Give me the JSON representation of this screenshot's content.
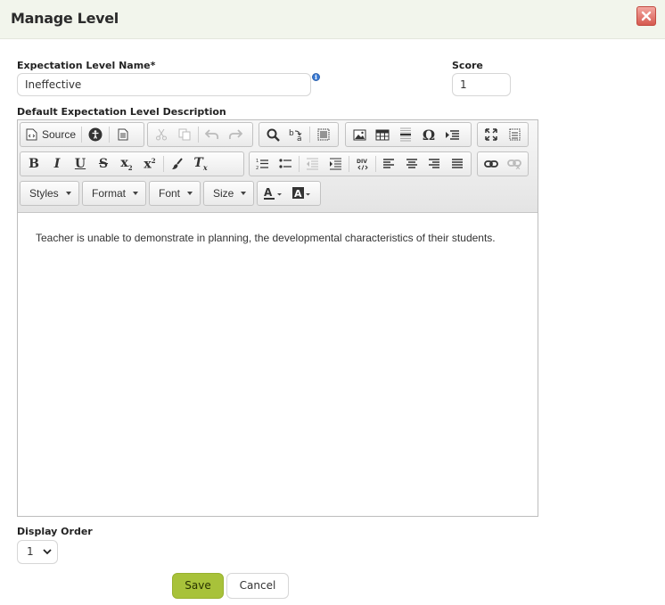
{
  "dialog": {
    "title": "Manage Level",
    "close_icon": "close-icon"
  },
  "form": {
    "level_name_label": "Expectation Level Name*",
    "level_name_value": "Ineffective",
    "score_label": "Score",
    "score_value": "1",
    "description_label": "Default Expectation Level Description",
    "display_order_label": "Display Order",
    "display_order_value": "1"
  },
  "editor": {
    "source_label": "Source",
    "combos": {
      "styles": "Styles",
      "format": "Format",
      "font": "Font",
      "size": "Size"
    },
    "content": "Teacher is unable to demonstrate in planning, the developmental characteristics of their students."
  },
  "buttons": {
    "save": "Save",
    "cancel": "Cancel"
  },
  "colors": {
    "header_bg": "#f2f5ec",
    "save_bg": "#a8c23a",
    "close_bg": "#d6594f"
  }
}
